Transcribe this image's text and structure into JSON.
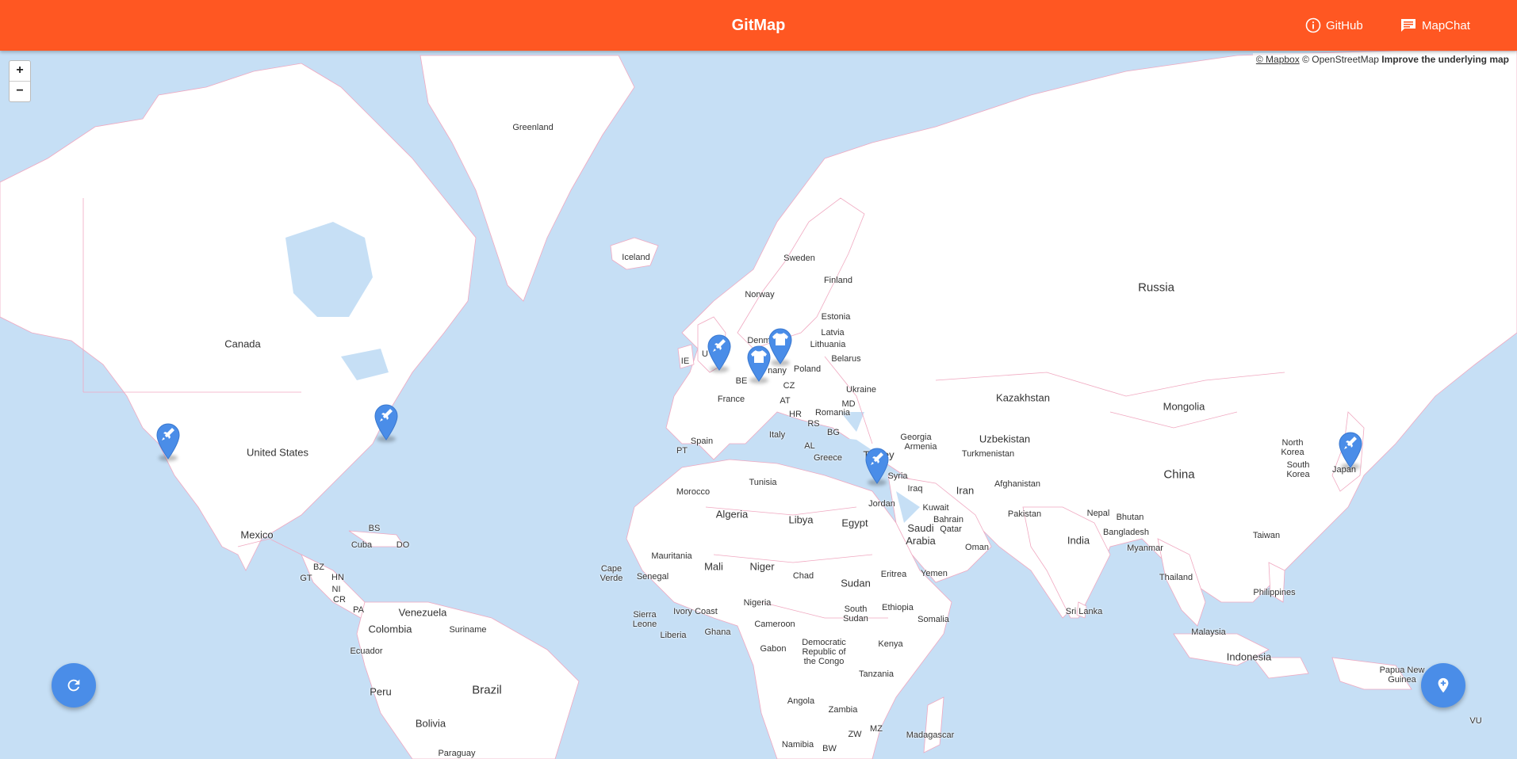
{
  "header": {
    "title": "GitMap",
    "github_label": "GitHub",
    "mapchat_label": "MapChat",
    "background_color": "#ff5722"
  },
  "map": {
    "attribution": {
      "mapbox": "© Mapbox",
      "osm": "© OpenStreetMap",
      "improve": "Improve the underlying map"
    },
    "zoom_in_label": "+",
    "zoom_out_label": "−",
    "labels": {
      "greenland": "Greenland",
      "iceland": "Iceland",
      "canada": "Canada",
      "united_states": "United States",
      "mexico": "Mexico",
      "bs": "BS",
      "cuba": "Cuba",
      "do": "DO",
      "bz": "BZ",
      "gt": "GT",
      "hn": "HN",
      "ni": "NI",
      "cr": "CR",
      "pa": "PA",
      "venezuela": "Venezuela",
      "colombia": "Colombia",
      "suriname": "Suriname",
      "ecuador": "Ecuador",
      "peru": "Peru",
      "brazil": "Brazil",
      "bolivia": "Bolivia",
      "paraguay": "Paraguay",
      "sweden": "Sweden",
      "norway": "Norway",
      "finland": "Finland",
      "estonia": "Estonia",
      "latvia": "Latvia",
      "lithuania": "Lithuania",
      "denmark": "Denm",
      "ie": "IE",
      "uk": "U",
      "germany": "nany",
      "poland": "Poland",
      "belarus": "Belarus",
      "be": "BE",
      "cz": "CZ",
      "france": "France",
      "at": "AT",
      "ukraine": "Ukraine",
      "md": "MD",
      "hr": "HR",
      "romania": "Romania",
      "rs": "RS",
      "bg": "BG",
      "italy": "Italy",
      "al": "AL",
      "greece": "Greece",
      "spain": "Spain",
      "pt": "PT",
      "russia": "Russia",
      "kazakhstan": "Kazakhstan",
      "mongolia": "Mongolia",
      "georgia": "Georgia",
      "armenia": "Armenia",
      "uzbekistan": "Uzbekistan",
      "turkmenistan": "Turkmenistan",
      "turkey": "Turkey",
      "syria": "Syria",
      "iraq": "Iraq",
      "iran": "Iran",
      "afghanistan": "Afghanistan",
      "jordan": "Jordan",
      "kuwait": "Kuwait",
      "bahrain": "Bahrain",
      "qatar": "Qatar",
      "pakistan": "Pakistan",
      "nepal": "Nepal",
      "bhutan": "Bhutan",
      "bangladesh": "Bangladesh",
      "china": "China",
      "north_korea": "North Korea",
      "south_korea": "South Korea",
      "japan": "Japan",
      "taiwan": "Taiwan",
      "india": "India",
      "myanmar": "Myanmar",
      "thailand": "Thailand",
      "philippines": "Philippines",
      "sri_lanka": "Sri Lanka",
      "malaysia": "Malaysia",
      "indonesia": "Indonesia",
      "papua": "Papua New Guinea",
      "vu": "VU",
      "saudi_arabia": "Saudi Arabia",
      "oman": "Oman",
      "yemen": "Yemen",
      "egypt": "Egypt",
      "libya": "Libya",
      "algeria": "Algeria",
      "tunisia": "Tunisia",
      "morocco": "Morocco",
      "mauritania": "Mauritania",
      "mali": "Mali",
      "niger": "Niger",
      "chad": "Chad",
      "sudan": "Sudan",
      "eritrea": "Eritrea",
      "ethiopia": "Ethiopia",
      "somalia": "Somalia",
      "south_sudan": "South Sudan",
      "cape_verde": "Cape Verde",
      "senegal": "Senegal",
      "sierra_leone": "Sierra Leone",
      "liberia": "Liberia",
      "ivory_coast": "Ivory Coast",
      "ghana": "Ghana",
      "nigeria": "Nigeria",
      "cameroon": "Cameroon",
      "gabon": "Gabon",
      "drc": "Democratic Republic of the Congo",
      "kenya": "Kenya",
      "tanzania": "Tanzania",
      "angola": "Angola",
      "zambia": "Zambia",
      "mz": "MZ",
      "zw": "ZW",
      "namibia": "Namibia",
      "bw": "BW",
      "madagascar": "Madagascar"
    },
    "markers": [
      {
        "name": "marker-california",
        "icon": "rocket-icon"
      },
      {
        "name": "marker-new-york",
        "icon": "rocket-icon"
      },
      {
        "name": "marker-uk",
        "icon": "rocket-icon"
      },
      {
        "name": "marker-germany-west",
        "icon": "shirt-icon"
      },
      {
        "name": "marker-germany-north",
        "icon": "shirt-icon"
      },
      {
        "name": "marker-israel",
        "icon": "rocket-icon"
      },
      {
        "name": "marker-japan",
        "icon": "rocket-icon"
      }
    ],
    "colors": {
      "water": "#c6dff5",
      "land": "#ffffff",
      "border": "#f0a8c0",
      "marker": "#4a8de8"
    }
  },
  "fabs": {
    "refresh_icon": "refresh-icon",
    "add_location_icon": "add-location-icon"
  }
}
